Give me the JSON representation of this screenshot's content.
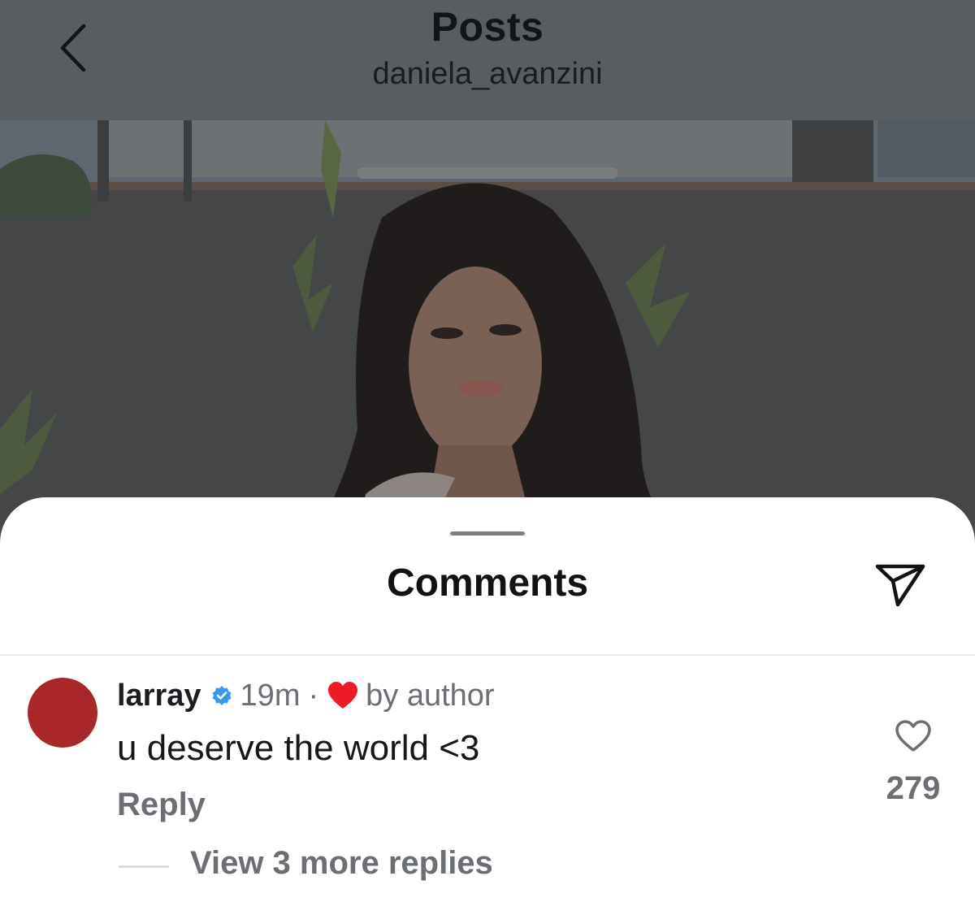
{
  "header": {
    "title": "Posts",
    "username": "daniela_avanzini"
  },
  "sheet": {
    "title": "Comments"
  },
  "comment": {
    "username": "larray",
    "time": "19m",
    "separator": "·",
    "liked_label": "by author",
    "text": "u deserve the world <3",
    "reply_label": "Reply",
    "like_count": "279",
    "view_replies_label": "View 3 more replies"
  },
  "colors": {
    "avatar": "#a8282a",
    "verified_badge": "#3897f0",
    "author_heart": "#ed1c24",
    "dimmed_overlay": "#595d60"
  },
  "icons": {
    "back": "chevron-left-icon",
    "share": "paper-plane-icon",
    "verified": "verified-badge-icon",
    "author_like": "heart-filled-icon",
    "like": "heart-outline-icon"
  }
}
